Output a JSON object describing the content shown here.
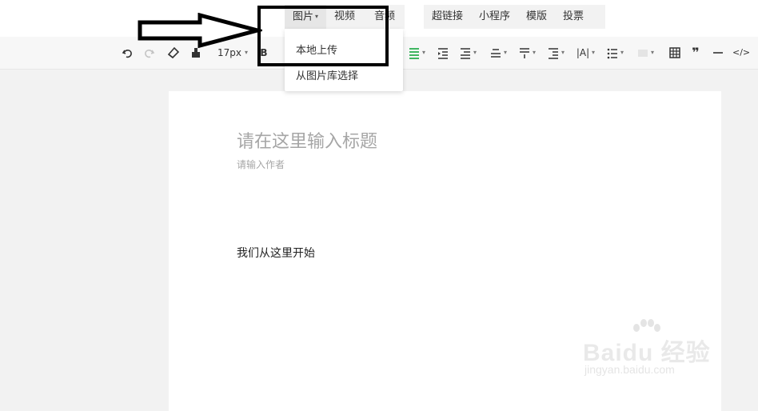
{
  "insert_menu": {
    "image": "图片",
    "video": "视频",
    "audio": "音频",
    "hyperlink": "超链接",
    "mini_program": "小程序",
    "template": "模版",
    "vote": "投票"
  },
  "image_dropdown": {
    "options": [
      "本地上传",
      "从图片库选择"
    ]
  },
  "toolbar": {
    "font_size": "17px",
    "bold": "B",
    "quote": "❞",
    "code": "</>"
  },
  "editor": {
    "title_placeholder": "请在这里输入标题",
    "author_placeholder": "请输入作者",
    "body": "我们从这里开始"
  },
  "watermark": {
    "brand": "Baidu 经验",
    "url": "jingyan.baidu.com"
  },
  "colors": {
    "accent_green": "#2bae52",
    "annotation": "#000000"
  }
}
